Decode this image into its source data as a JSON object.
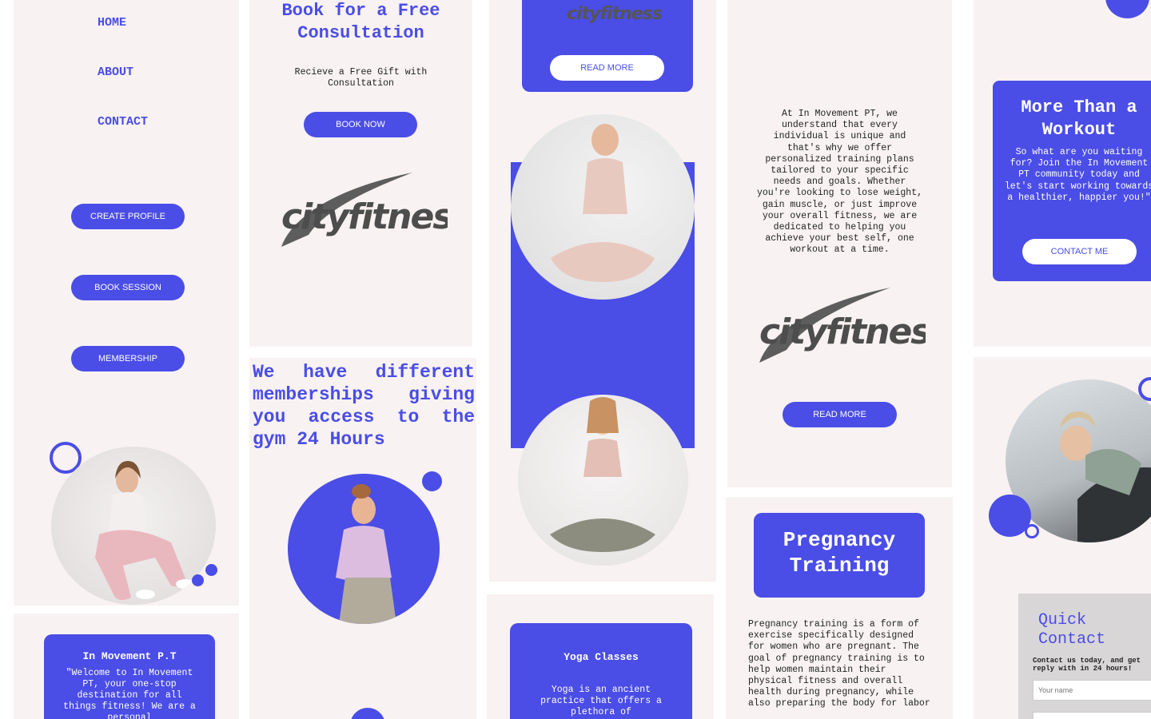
{
  "nav": {
    "home": "HOME",
    "about": "ABOUT",
    "contact": "CONTACT"
  },
  "buttons": {
    "create_profile": "CREATE PROFILE",
    "book_session": "BOOK SESSION",
    "membership": "MEMBERSHIP",
    "book_now": "BOOK NOW",
    "read_more": "READ MORE",
    "contact_me": "CONTACT ME"
  },
  "consult": {
    "title": "Book for a Free Consultation",
    "subtitle": "Recieve a Free Gift with Consultation"
  },
  "logo_text": "cityfitness",
  "membership_headline": "We have different memberships giving you access to the gym 24 Hours",
  "about": {
    "title": "In Movement P.T",
    "text": "\"Welcome to In Movement PT, your one-stop destination for all things fitness! We are a personal"
  },
  "yoga": {
    "title": "Yoga Classes",
    "text": "Yoga is an ancient practice that offers a plethora of"
  },
  "approach_text": "At In Movement PT, we understand that every individual is unique and that's why we offer personalized training plans tailored to your specific needs and goals. Whether you're looking to lose weight, gain muscle, or just improve your overall fitness, we are dedicated to helping you achieve your best self, one workout at a time.",
  "pregnancy": {
    "title": "Pregnancy Training",
    "text": "Pregnancy training is a form of exercise specifically designed for women who are pregnant. The goal of pregnancy training is to help women maintain their physical fitness and overall health during pregnancy, while also preparing the body for labor"
  },
  "workout": {
    "title": "More Than a Workout",
    "text": "So what are you waiting for? Join the In Movement PT community today and let's start working towards a healthier, happier you!\""
  },
  "quick_contact": {
    "title": "Quick Contact",
    "text": "Contact us today, and get reply with in 24 hours!",
    "name_placeholder": "Your name"
  },
  "colors": {
    "accent": "#4a4de6",
    "card": "#f8f2f2",
    "form_bg": "#d8d6d6"
  }
}
